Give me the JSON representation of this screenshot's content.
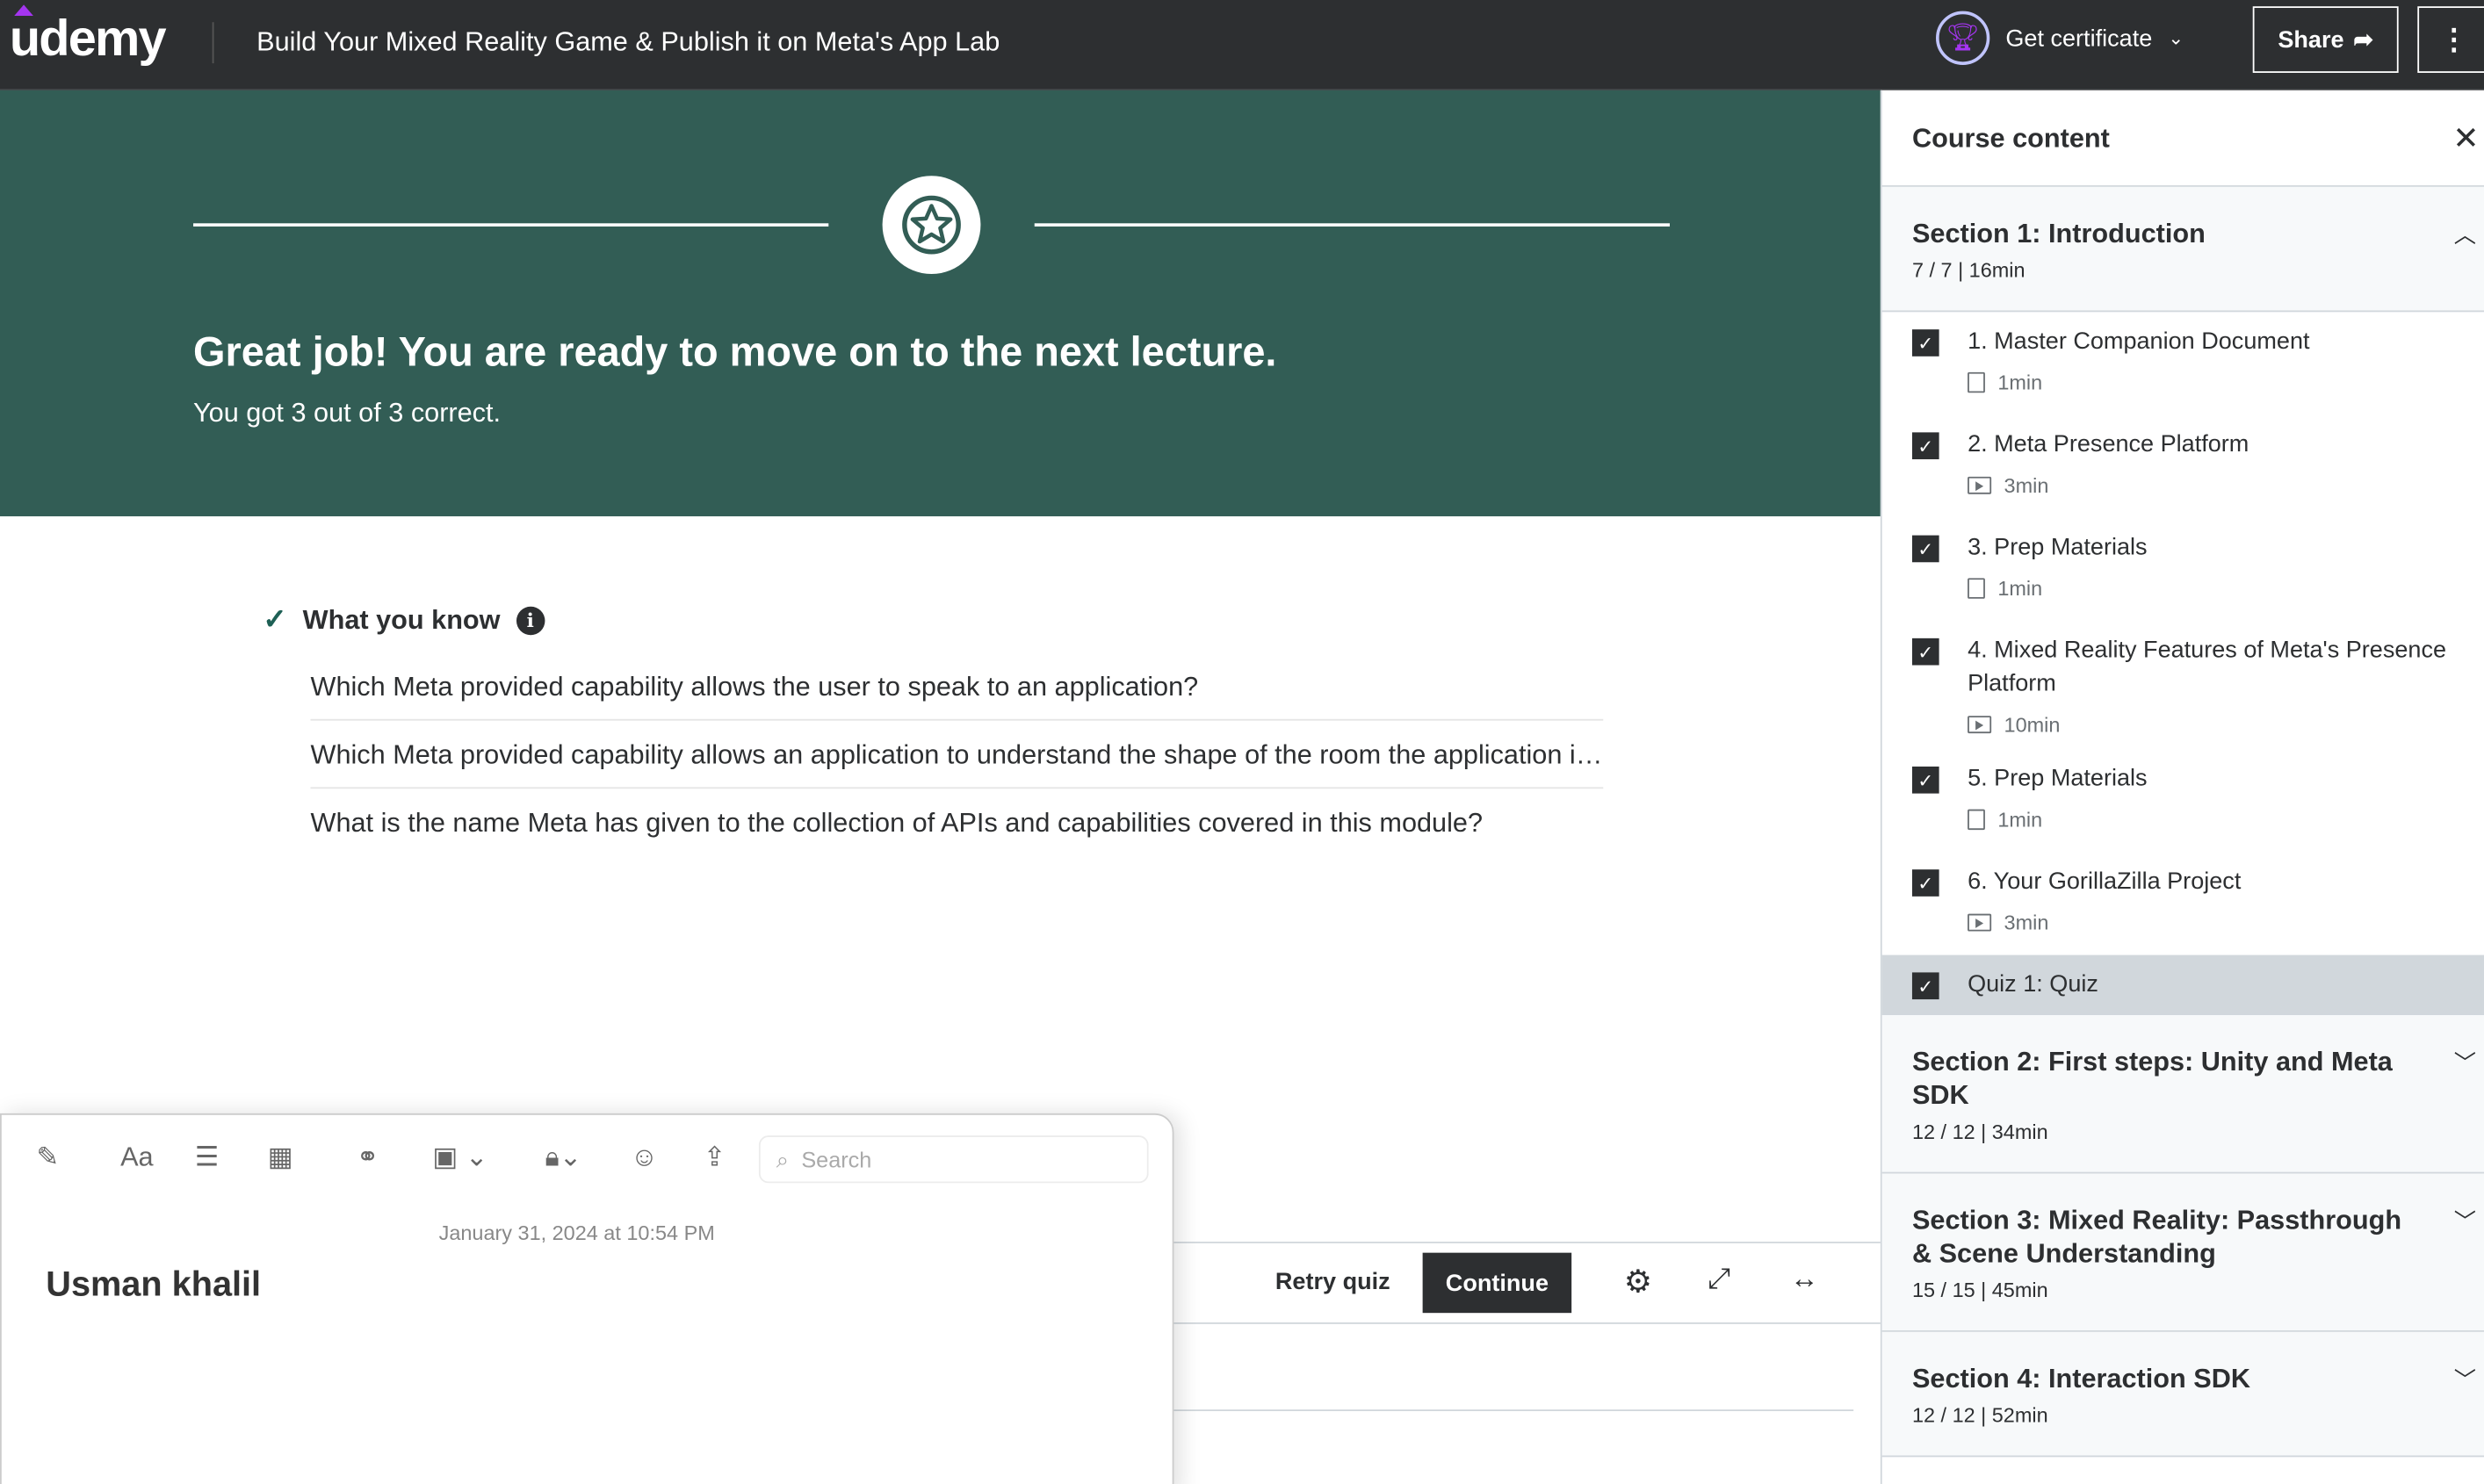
{
  "header": {
    "logo": "udemy",
    "course_title": "Build Your Mixed Reality Game & Publish it on Meta's App Lab",
    "certificate_label": "Get certificate",
    "share_label": "Share",
    "brand_color": "#a435f0"
  },
  "result": {
    "heading": "Great job! You are ready to move on to the next lecture.",
    "score": "You got 3 out of 3 correct.",
    "banner_color": "#325d55"
  },
  "knowledge": {
    "title": "What you know",
    "questions": [
      "Which Meta provided capability allows the user to speak to an application?",
      "Which Meta provided capability allows an application to understand the shape of the room the application is running in?",
      "What is the name Meta has given to the collection of APIs and capabilities covered in this module?"
    ]
  },
  "footer": {
    "retry_label": "Retry quiz",
    "continue_label": "Continue"
  },
  "notes": {
    "search_placeholder": "Search",
    "date": "January 31, 2024 at 10:54 PM",
    "title": "Usman khalil"
  },
  "sidebar": {
    "title": "Course content",
    "sections": [
      {
        "title": "Section 1: Introduction",
        "meta": "7 / 7 | 16min",
        "expanded": true,
        "items": [
          {
            "title": "1. Master Companion Document",
            "duration": "1min",
            "type": "document",
            "done": true
          },
          {
            "title": "2. Meta Presence Platform",
            "duration": "3min",
            "type": "video",
            "done": true
          },
          {
            "title": "3. Prep Materials",
            "duration": "1min",
            "type": "document",
            "done": true
          },
          {
            "title": "4. Mixed Reality Features of Meta's Presence Platform",
            "duration": "10min",
            "type": "video",
            "done": true
          },
          {
            "title": "5. Prep Materials",
            "duration": "1min",
            "type": "document",
            "done": true
          },
          {
            "title": "6. Your GorillaZilla Project",
            "duration": "3min",
            "type": "video",
            "done": true
          },
          {
            "title": "Quiz 1: Quiz",
            "type": "quiz",
            "done": true,
            "active": true
          }
        ]
      },
      {
        "title": "Section 2: First steps: Unity and Meta SDK",
        "meta": "12 / 12 | 34min"
      },
      {
        "title": "Section 3: Mixed Reality: Passthrough & Scene Understanding",
        "meta": "15 / 15 | 45min"
      },
      {
        "title": "Section 4: Interaction SDK",
        "meta": "12 / 12 | 52min"
      }
    ]
  }
}
